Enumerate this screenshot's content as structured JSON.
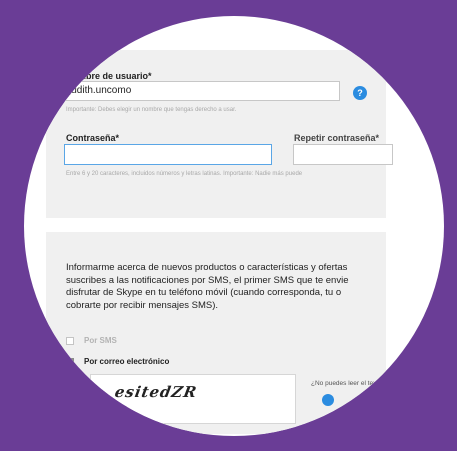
{
  "form": {
    "username": {
      "label": "Nombre de usuario*",
      "value": "judith.uncomo",
      "hint": "Importante: Debes elegir un nombre que tengas derecho a usar."
    },
    "help_icon_glyph": "?",
    "password": {
      "label": "Contraseña*",
      "repeat_label": "Repetir contraseña*",
      "hint": "Entre 6 y 20 caracteres, incluidos números y letras latinas. Importante: Nadie más puede"
    }
  },
  "notifications": {
    "paragraph_lines": [
      "Informarme acerca de nuevos productos o características y ofertas",
      "suscribes a las notificaciones por SMS, el primer SMS que te envie",
      "disfrutar de Skype en tu teléfono móvil (cuando corresponda, tu o",
      "cobrarte por recibir mensajes SMS)."
    ],
    "sms_label": "Por SMS",
    "email_label": "Por correo electrónico"
  },
  "captcha": {
    "text": "esitedZR",
    "help_text": "¿No puedes leer el texto e"
  },
  "colors": {
    "background": "#6a3d96",
    "accent": "#2b8ce0"
  },
  "icons": {
    "help": "question-circle-icon"
  }
}
